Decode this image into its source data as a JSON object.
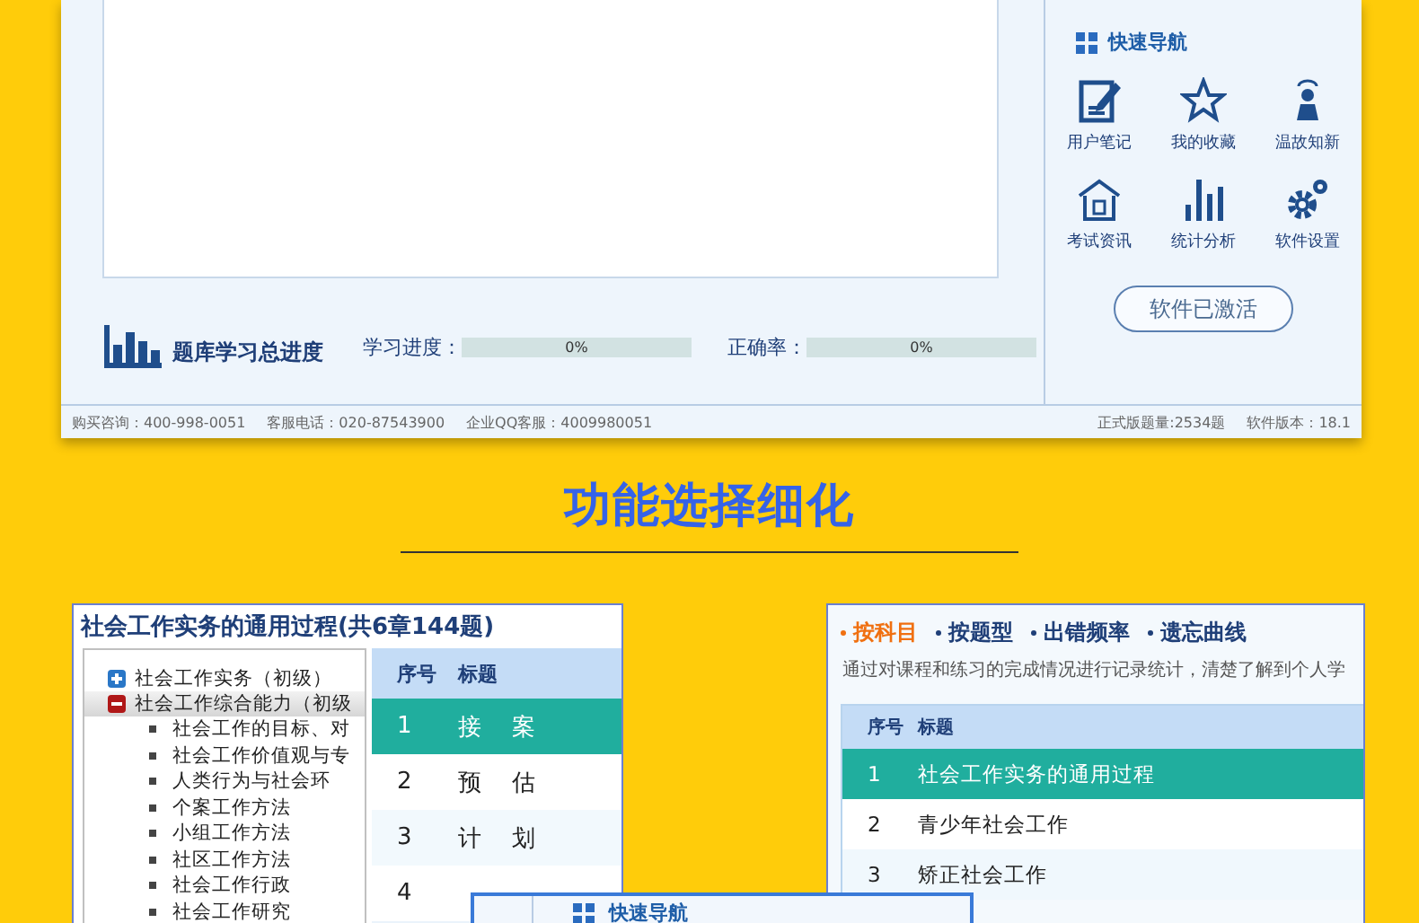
{
  "top_window": {
    "progress_title": "题库学习总进度",
    "meters": [
      {
        "label": "学习进度：",
        "reading": "0%",
        "level": 0
      },
      {
        "label": "正确率：",
        "reading": "0%",
        "level": 0
      }
    ],
    "quick_nav": {
      "title": "快速导航",
      "items": [
        {
          "label": "用户笔记",
          "kind": "notes"
        },
        {
          "label": "我的收藏",
          "kind": "star"
        },
        {
          "label": "温故知新",
          "kind": "person"
        },
        {
          "label": "考试资讯",
          "kind": "house"
        },
        {
          "label": "统计分析",
          "kind": "bars"
        },
        {
          "label": "软件设置",
          "kind": "gears"
        }
      ],
      "activate_button": "软件已激活"
    },
    "status_bar": {
      "left": [
        "购买咨询：400-998-0051",
        "客服电话：020-87543900",
        "企业QQ客服：4009980051"
      ],
      "right": [
        "正式版题量:2534题",
        "软件版本：18.1"
      ]
    }
  },
  "section_heading": "功能选择细化",
  "chapter_panel": {
    "title": "社会工作实务的通用过程(共6章144题)",
    "tree": [
      {
        "label": "社会工作实务（初级）",
        "expanded": false,
        "selected": false
      },
      {
        "label": "社会工作综合能力（初级",
        "expanded": true,
        "selected": true,
        "children": [
          {
            "label": "社会工作的目标、对"
          },
          {
            "label": "社会工作价值观与专"
          },
          {
            "label": "人类行为与社会环"
          },
          {
            "label": "个案工作方法"
          },
          {
            "label": "小组工作方法"
          },
          {
            "label": "社区工作方法"
          },
          {
            "label": "社会工作行政"
          },
          {
            "label": "社会工作研究"
          }
        ]
      }
    ],
    "columns": [
      "序号",
      "标题"
    ],
    "rows": [
      {
        "index": "1",
        "title": "接　案",
        "selected": true
      },
      {
        "index": "2",
        "title": "预　估",
        "selected": false
      },
      {
        "index": "3",
        "title": "计　划",
        "selected": false
      },
      {
        "index": "4",
        "selected": false
      }
    ]
  },
  "stats_panel": {
    "tabs": [
      {
        "label": "按科目",
        "selected": true
      },
      {
        "label": "按题型",
        "selected": false
      },
      {
        "label": "出错频率",
        "selected": false
      },
      {
        "label": "遗忘曲线",
        "selected": false
      }
    ],
    "description": "通过对课程和练习的完成情况进行记录统计，清楚了解到个人学",
    "columns": [
      "序号",
      "标题"
    ],
    "rows": [
      {
        "index": "1",
        "title": "社会工作实务的通用过程",
        "selected": true
      },
      {
        "index": "2",
        "title": "青少年社会工作",
        "selected": false
      },
      {
        "index": "3",
        "title": "矫正社会工作",
        "selected": false
      }
    ]
  },
  "overlay_window": {
    "title": "快速导航"
  }
}
